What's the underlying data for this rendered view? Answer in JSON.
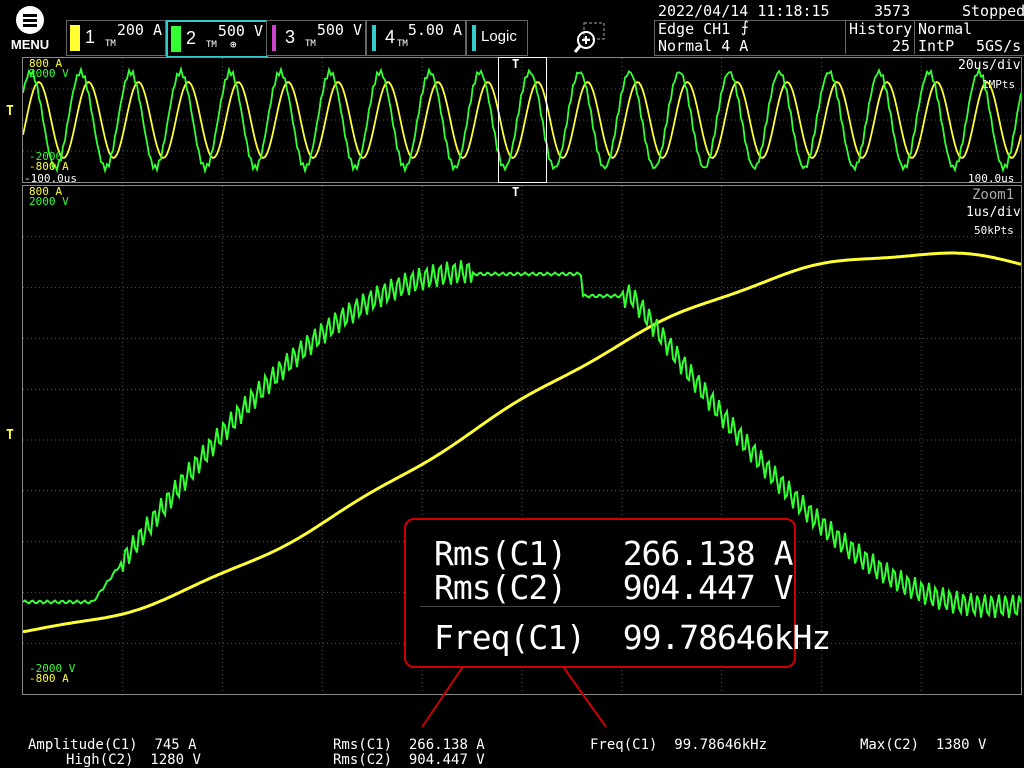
{
  "menu": {
    "label": "MENU"
  },
  "channels": [
    {
      "num": "1",
      "value": "200 A",
      "coupling": "TM",
      "color": "#ffff33"
    },
    {
      "num": "2",
      "value": "500 V",
      "coupling": "TM",
      "color": "#33ff33",
      "selected": true
    },
    {
      "num": "3",
      "value": "500 V",
      "coupling": "TM",
      "color": "#cc44cc"
    },
    {
      "num": "4",
      "value": "5.00 A",
      "coupling": "TM",
      "color": "#33cccc"
    }
  ],
  "logic": {
    "label": "Logic"
  },
  "status": {
    "datetime": "2022/04/14 11:18:15",
    "count": "3573",
    "state": "Stopped",
    "trigger_type": "Edge CH1",
    "trigger_mode": "Normal 4 A",
    "history_label": "History",
    "history_value": "25",
    "acq_mode": "Normal",
    "interp": "IntP",
    "sample_rate": "5GS/s"
  },
  "overview": {
    "ch1_top": "800 A",
    "ch2_top": "2000 V",
    "ch2_bottom": "-2000",
    "ch1_bottom": "-800 A",
    "time_left": "-100.0us",
    "time_right": "100.0us",
    "timebase": "20us/div",
    "record": "1MPts",
    "trigger_marker": "T"
  },
  "zoom": {
    "title": "Zoom1",
    "ch1_top": "800 A",
    "ch2_top": "2000 V",
    "ch2_bottom": "-2000 V",
    "ch1_bottom": "-800 A",
    "timebase": "1us/div",
    "record": "50kPts",
    "trigger_marker": "T"
  },
  "measurement_box": {
    "rows": [
      {
        "name": "Rms(C1)",
        "value": "266.138 A"
      },
      {
        "name": "Rms(C2)",
        "value": "904.447 V"
      },
      {
        "name": "Freq(C1)",
        "value": "99.78646kHz"
      }
    ]
  },
  "bottom": {
    "amplitude_label": "Amplitude(C1)",
    "amplitude_value": "745 A",
    "high_label": "High(C2)",
    "high_value": "1280 V",
    "rms1_label": "Rms(C1)",
    "rms1_value": "266.138 A",
    "rms2_label": "Rms(C2)",
    "rms2_value": "904.447 V",
    "freq_label": "Freq(C1)",
    "freq_value": "99.78646kHz",
    "max_label": "Max(C2)",
    "max_value": "1380 V"
  }
}
